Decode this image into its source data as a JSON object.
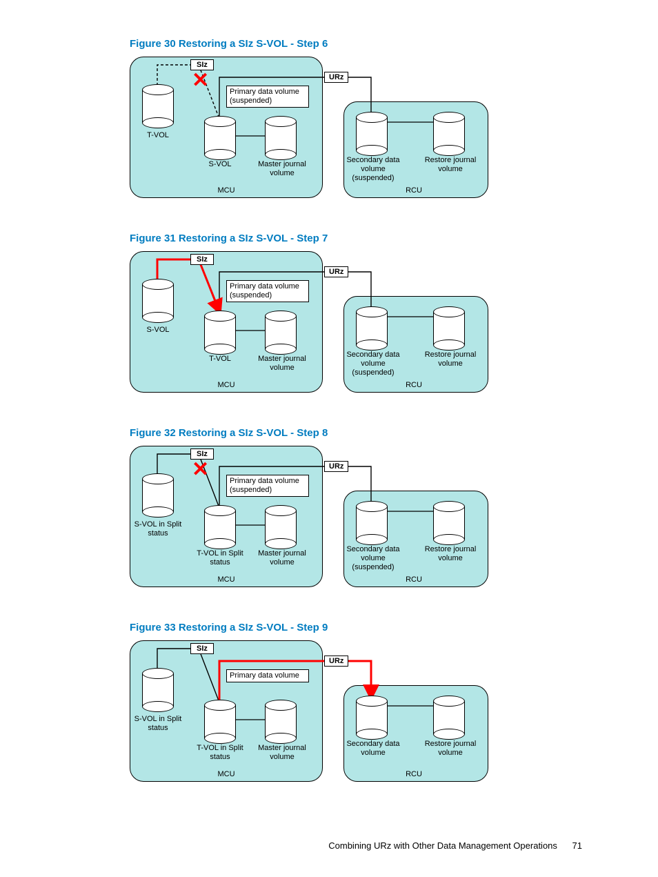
{
  "figures": [
    {
      "title": "Figure 30 Restoring a SIz S-VOL - Step 6",
      "siz": "SIz",
      "urz": "URz",
      "mcu": "MCU",
      "rcu": "RCU",
      "left_vol": "T-VOL",
      "mid_vol": "S-VOL",
      "mj_vol": "Master journal volume",
      "primary_box": "Primary data volume (suspended)",
      "sec_vol": "Secondary data volume (suspended)",
      "rj_vol": "Restore journal volume",
      "hasX": true,
      "redArrow": "none",
      "sizDashed": true
    },
    {
      "title": "Figure 31 Restoring a SIz S-VOL - Step 7",
      "siz": "SIz",
      "urz": "URz",
      "mcu": "MCU",
      "rcu": "RCU",
      "left_vol": "S-VOL",
      "mid_vol": "T-VOL",
      "mj_vol": "Master journal volume",
      "primary_box": "Primary data volume (suspended)",
      "sec_vol": "Secondary data volume (suspended)",
      "rj_vol": "Restore journal volume",
      "hasX": false,
      "redArrow": "mcu",
      "sizDashed": false
    },
    {
      "title": "Figure 32 Restoring a SIz S-VOL - Step 8",
      "siz": "SIz",
      "urz": "URz",
      "mcu": "MCU",
      "rcu": "RCU",
      "left_vol": "S-VOL in Split status",
      "mid_vol": "T-VOL in Split status",
      "mj_vol": "Master journal volume",
      "primary_box": "Primary data volume (suspended)",
      "sec_vol": "Secondary data volume (suspended)",
      "rj_vol": "Restore journal volume",
      "hasX": true,
      "redArrow": "none",
      "sizDashed": false
    },
    {
      "title": "Figure 33 Restoring a SIz S-VOL - Step 9",
      "siz": "SIz",
      "urz": "URz",
      "mcu": "MCU",
      "rcu": "RCU",
      "left_vol": "S-VOL in Split status",
      "mid_vol": "T-VOL in Split status",
      "mj_vol": "Master journal volume",
      "primary_box": "Primary data volume",
      "sec_vol": "Secondary data volume",
      "rj_vol": "Restore journal volume",
      "hasX": false,
      "redArrow": "rcu",
      "sizDashed": false
    }
  ],
  "footer_text": "Combining URz with Other Data Management Operations",
  "page_number": "71"
}
